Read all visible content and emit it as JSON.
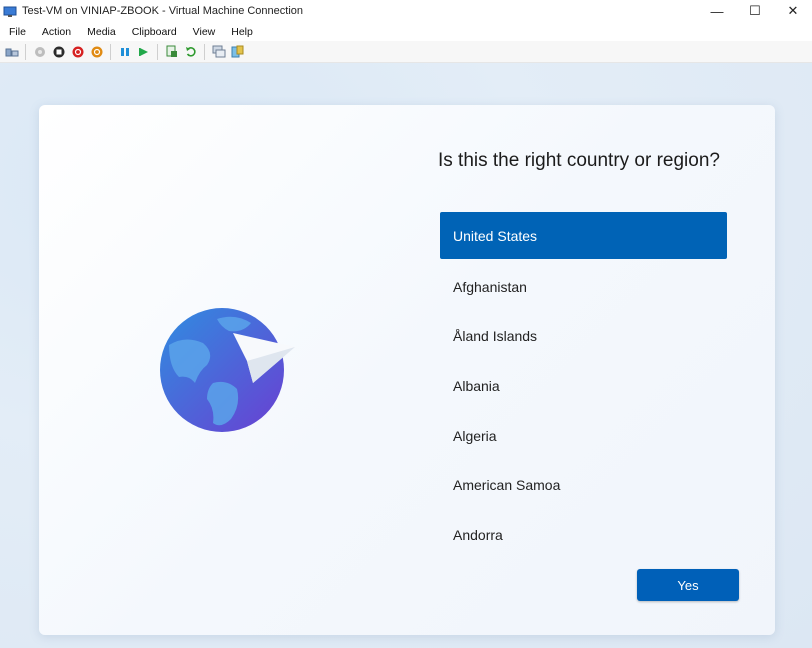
{
  "window": {
    "title": "Test-VM on VINIAP-ZBOOK - Virtual Machine Connection",
    "minimize_glyph": "—",
    "maximize_glyph": "☐",
    "close_glyph": "✕"
  },
  "menu": [
    "File",
    "Action",
    "Media",
    "Clipboard",
    "View",
    "Help"
  ],
  "toolbar": {
    "icons": [
      "ctrl-alt-del-icon",
      "start-icon",
      "turn-off-icon",
      "shut-down-icon",
      "save-state-icon",
      "pause-icon",
      "resume-icon",
      "checkpoint-icon",
      "revert-icon",
      "enhanced-session-icon",
      "share-icon"
    ]
  },
  "oobe": {
    "question": "Is this the right country or region?",
    "countries": [
      "United States",
      "Afghanistan",
      "Åland Islands",
      "Albania",
      "Algeria",
      "American Samoa",
      "Andorra"
    ],
    "selected_index": 0,
    "yes_label": "Yes"
  },
  "colors": {
    "accent": "#0063b6",
    "yes_button": "#0060b8",
    "background": "#dce7f3"
  }
}
